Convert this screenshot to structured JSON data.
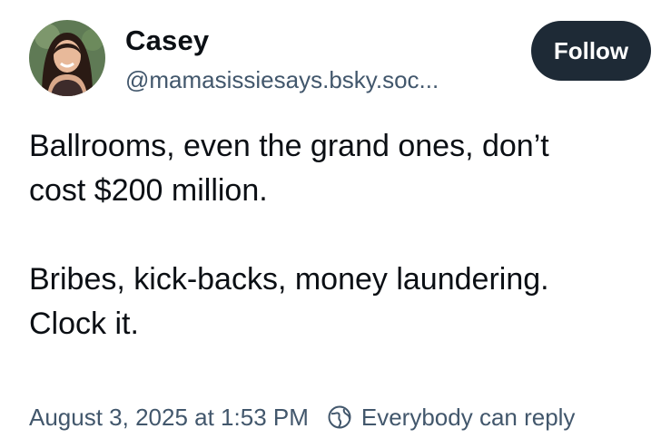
{
  "author": {
    "display_name": "Casey",
    "handle": "@mamasissiesays.bsky.soc...",
    "avatar_icon": "avatar-photo"
  },
  "follow_label": "Follow",
  "post": {
    "lines": [
      "Ballrooms, even the grand ones, don’t",
      "cost $200 million.",
      "Bribes, kick-backs, money laundering.",
      "Clock it."
    ]
  },
  "footer": {
    "timestamp": "August 3, 2025 at 1:53 PM",
    "reply_setting": "Everybody can reply",
    "reply_icon": "globe-icon"
  },
  "colors": {
    "button_bg": "#1e2a36",
    "muted_text": "#42576c",
    "text": "#0b0f14"
  }
}
